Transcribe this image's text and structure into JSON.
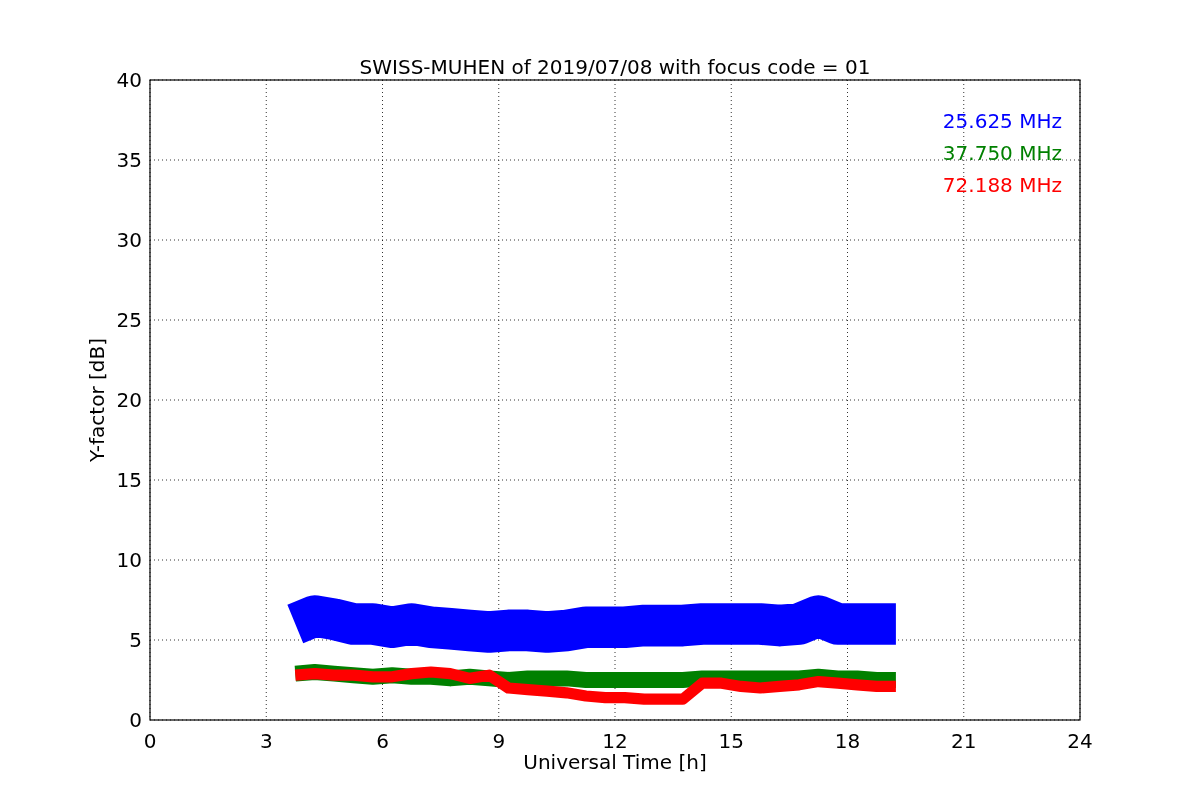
{
  "chart_data": {
    "type": "line",
    "title": "SWISS-MUHEN of 2019/07/08 with focus code = 01",
    "xlabel": "Universal Time [h]",
    "ylabel": "Y-factor [dB]",
    "x": [
      3.75,
      4.25,
      4.75,
      5.25,
      5.75,
      6.25,
      6.75,
      7.25,
      7.75,
      8.25,
      8.75,
      9.25,
      9.75,
      10.25,
      10.75,
      11.25,
      11.75,
      12.25,
      12.75,
      13.25,
      13.75,
      14.25,
      14.75,
      15.25,
      15.75,
      16.25,
      16.75,
      17.25,
      17.75,
      18.25,
      18.75,
      19.25
    ],
    "series": [
      {
        "name": "25.625 MHz",
        "color": "#0000ff",
        "values": [
          6,
          6.5,
          6.3,
          6,
          6,
          5.8,
          6,
          5.8,
          5.7,
          5.6,
          5.5,
          5.6,
          5.6,
          5.5,
          5.6,
          5.8,
          5.8,
          5.8,
          5.9,
          5.9,
          5.9,
          6,
          6,
          6,
          6,
          5.9,
          6,
          6.5,
          6,
          6,
          6,
          6
        ]
      },
      {
        "name": "37.750 MHz",
        "color": "#008000",
        "values": [
          2.9,
          3.0,
          2.9,
          2.8,
          2.7,
          2.8,
          2.7,
          2.7,
          2.6,
          2.7,
          2.6,
          2.5,
          2.6,
          2.6,
          2.6,
          2.5,
          2.5,
          2.5,
          2.5,
          2.5,
          2.5,
          2.6,
          2.6,
          2.6,
          2.6,
          2.6,
          2.6,
          2.7,
          2.6,
          2.6,
          2.5,
          2.5
        ]
      },
      {
        "name": "72.188 MHz",
        "color": "#ff0000",
        "values": [
          2.8,
          2.9,
          2.8,
          2.8,
          2.7,
          2.7,
          2.9,
          3.0,
          2.9,
          2.6,
          2.8,
          2.0,
          1.9,
          1.8,
          1.7,
          1.5,
          1.4,
          1.4,
          1.3,
          1.3,
          1.3,
          2.3,
          2.3,
          2.1,
          2.0,
          2.1,
          2.2,
          2.4,
          2.3,
          2.2,
          2.1,
          2.1
        ]
      }
    ],
    "grid": true,
    "xlim": [
      0,
      24
    ],
    "ylim": [
      0,
      40
    ],
    "xticks": [
      0,
      3,
      6,
      9,
      12,
      15,
      18,
      21,
      24
    ],
    "yticks": [
      0,
      5,
      10,
      15,
      20,
      25,
      30,
      35,
      40
    ]
  }
}
